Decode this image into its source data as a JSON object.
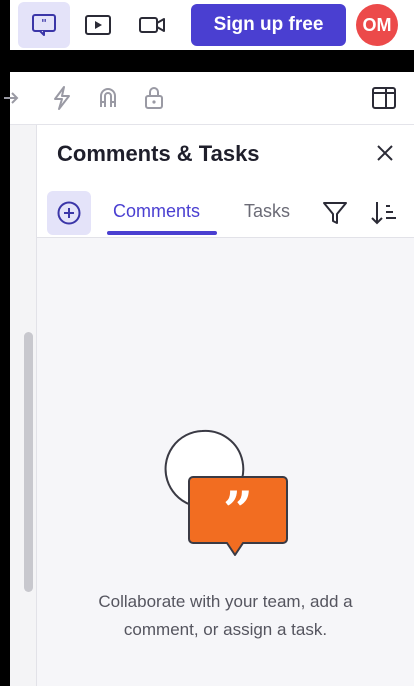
{
  "toolbar": {
    "signup_label": "Sign up free",
    "avatar_initials": "OM"
  },
  "panel": {
    "title": "Comments & Tasks",
    "tabs": [
      {
        "label": "Comments",
        "active": true
      },
      {
        "label": "Tasks",
        "active": false
      }
    ],
    "empty_state": {
      "line1": "Collaborate with your team, add a",
      "line2": "comment, or assign a task."
    }
  },
  "colors": {
    "accent": "#4a3fd1",
    "avatar": "#ec4a4a",
    "illustration_bubble": "#f26d21"
  },
  "icons": [
    "comment-icon",
    "play-icon",
    "video-camera-icon",
    "arrow-icon",
    "lightning-icon",
    "magnet-icon",
    "lock-icon",
    "panel-layout-icon",
    "close-icon",
    "plus-circle-icon",
    "filter-icon",
    "sort-icon"
  ]
}
